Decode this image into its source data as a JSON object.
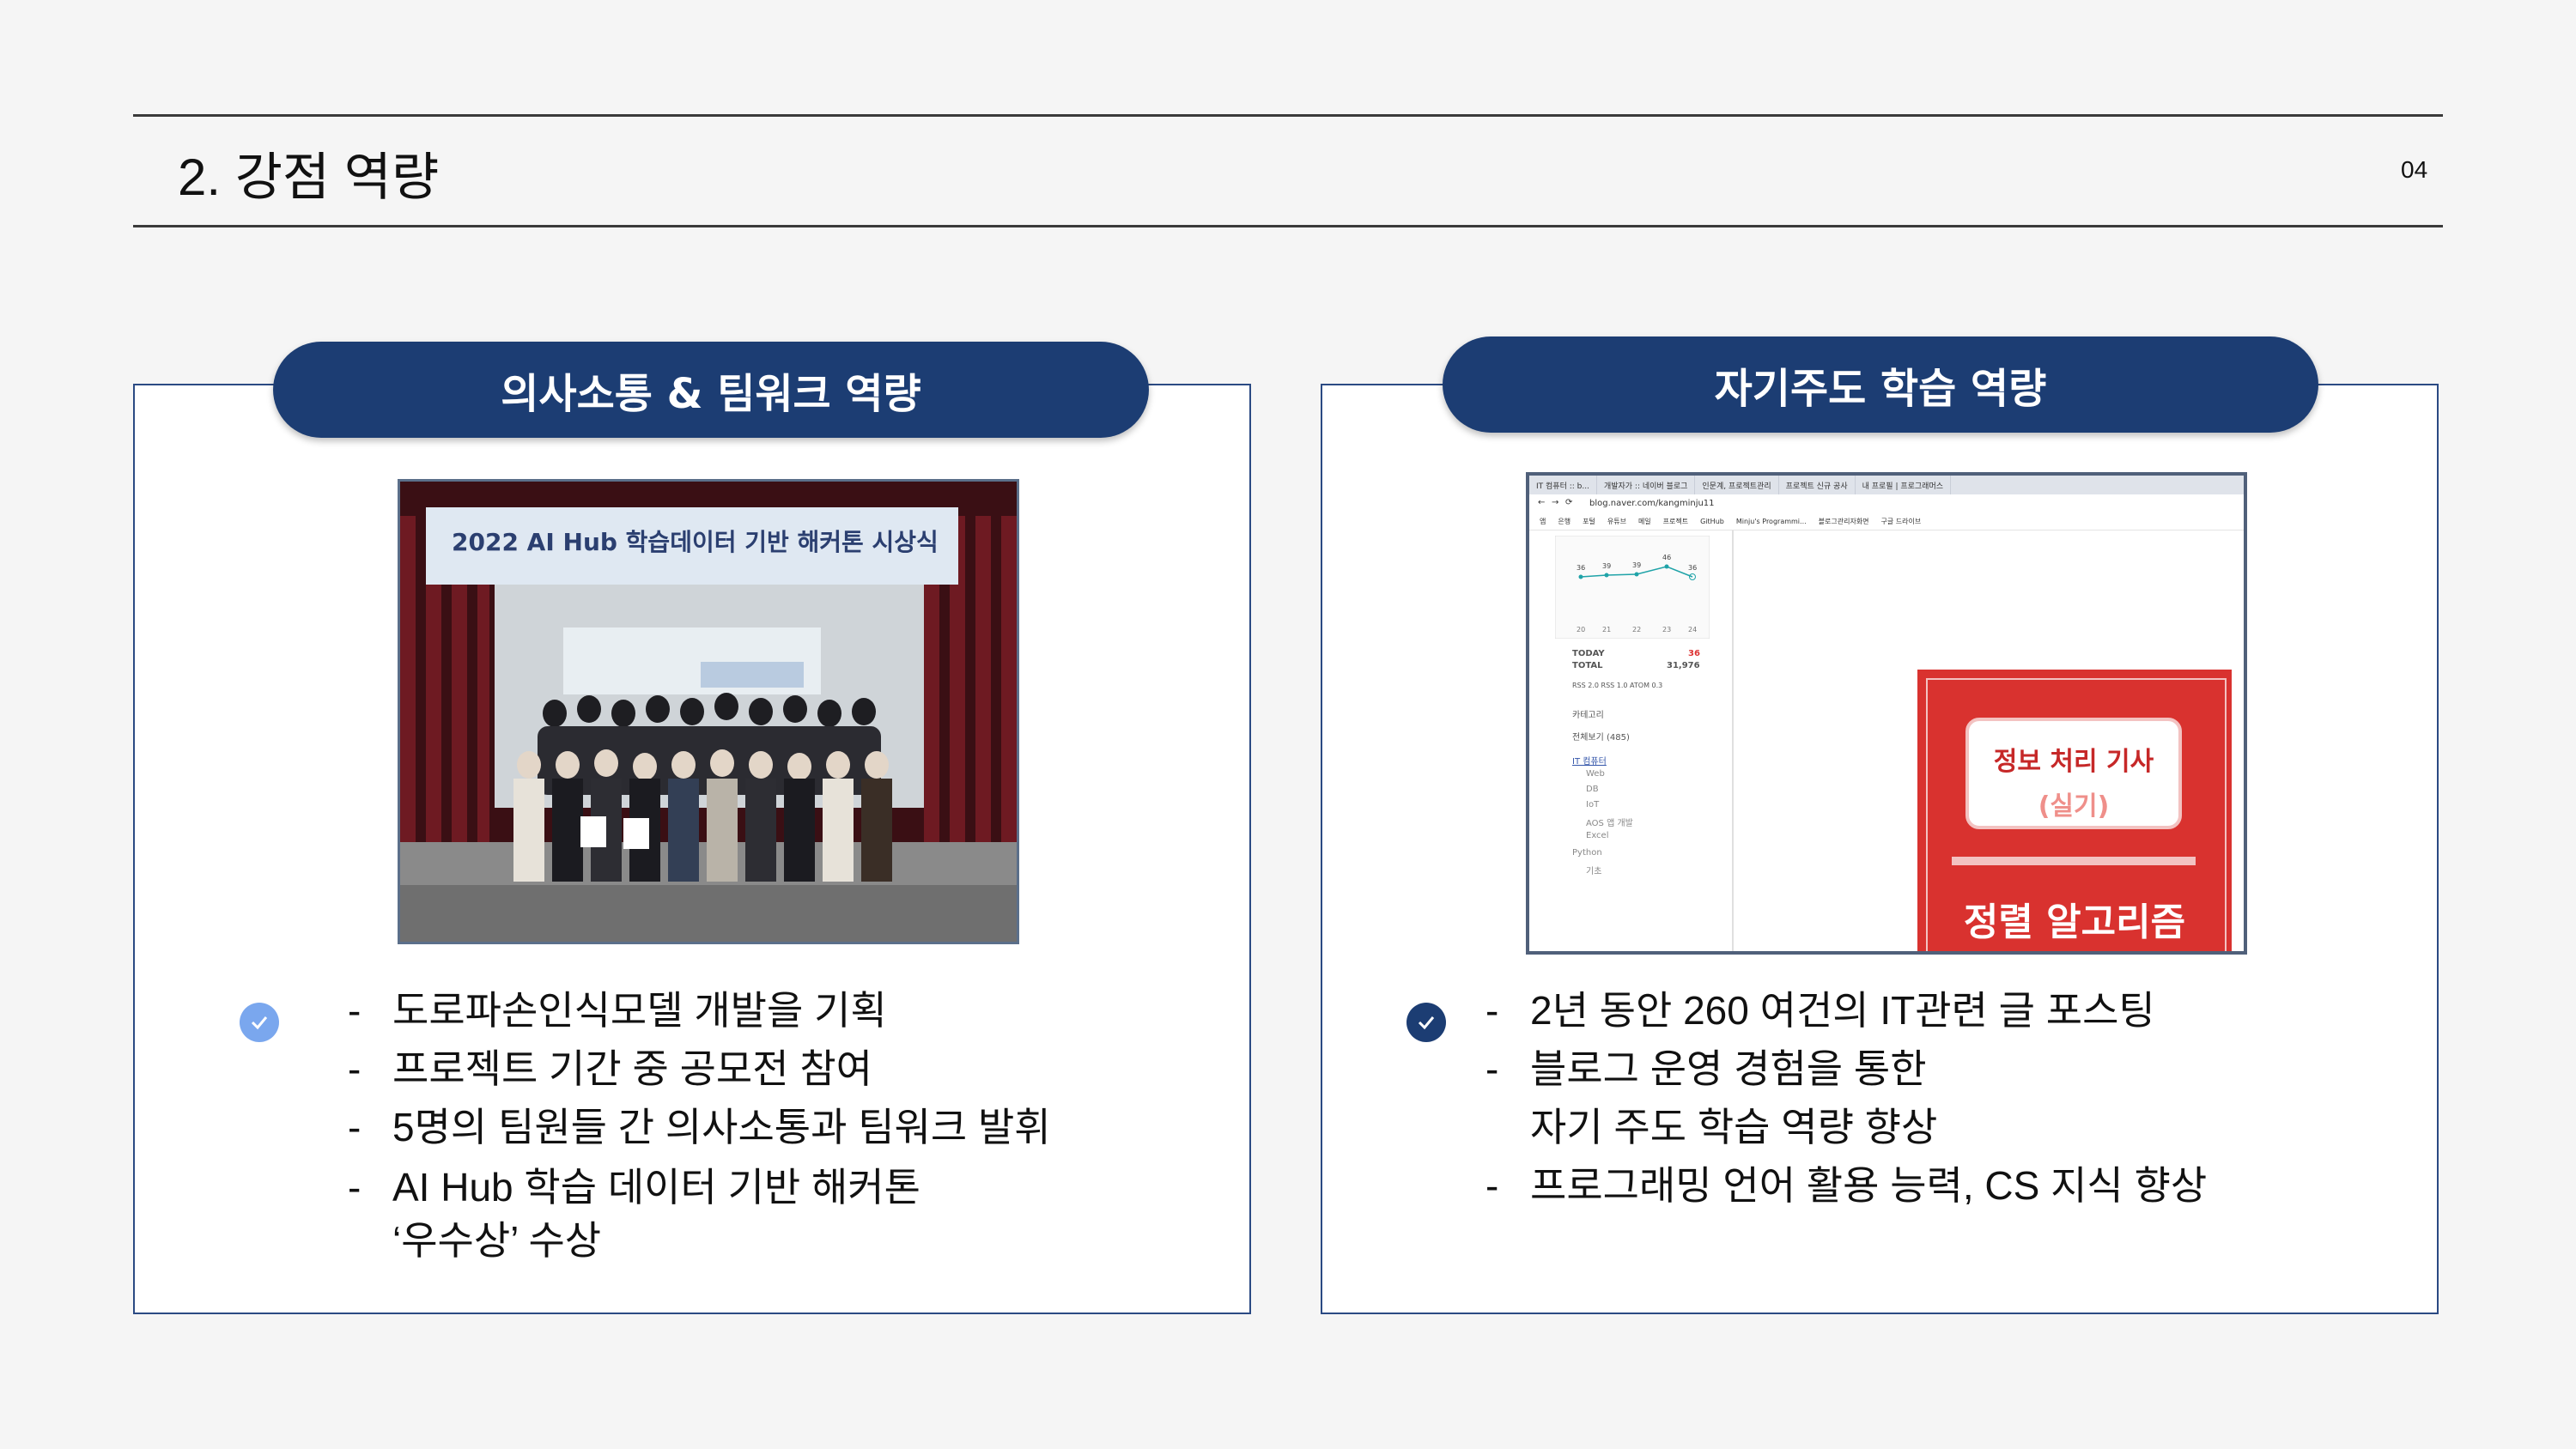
{
  "header": {
    "title": "2. 강점 역량",
    "page_number": "04"
  },
  "left_card": {
    "heading": "의사소통 & 팀워크 역량",
    "photo": {
      "banner_text": "2022 AI Hub 학습데이터 기반 해커톤 시상식",
      "description_icon": "group-photo-icon"
    },
    "bullets": [
      {
        "lines": [
          "도로파손인식모델 개발을 기획"
        ]
      },
      {
        "lines": [
          "프로젝트 기간 중 공모전 참여"
        ]
      },
      {
        "lines": [
          "5명의 팀원들 간 의사소통과 팀워크 발휘"
        ]
      },
      {
        "lines": [
          "AI Hub 학습 데이터 기반 해커톤",
          "‘우수상’ 수상"
        ]
      }
    ],
    "check_color": "#7aa7ee"
  },
  "right_card": {
    "heading": "자기주도 학습 역량",
    "screenshot": {
      "tabs": [
        "IT 컴퓨터 :: b...",
        "개발자가 :: 네이버 블로그",
        "인문계, 프로젝트관리",
        "프로젝트 신규 공사",
        "내 프로필 | 프로그래머스"
      ],
      "url": "blog.naver.com/kangminju11",
      "bookmarks": [
        "앱",
        "은행",
        "포털",
        "유튜브",
        "메일",
        "프로젝트",
        "GitHub",
        "Minju's Programmi...",
        "블로그관리자화면",
        "구글 드라이브"
      ],
      "graph_values": [
        "36",
        "39",
        "39",
        "46",
        "36"
      ],
      "graph_days": [
        "20",
        "21",
        "22",
        "23",
        "24"
      ],
      "today_label": "TODAY",
      "today_value": "36",
      "total_label": "TOTAL",
      "total_value": "31,976",
      "rss": "RSS 2.0   RSS 1.0   ATOM 0.3",
      "category_title": "카테고리",
      "categories": [
        "전체보기 (485)",
        "IT 컴퓨터",
        "Web",
        "DB",
        "IoT",
        "AOS 앱 개발",
        "Excel",
        "Python",
        "기초"
      ],
      "book_title": "정보 처리 기사",
      "book_subtitle": "(실기)",
      "book_bottom": "정렬 알고리즘"
    },
    "bullets": [
      {
        "lines": [
          "2년 동안 260 여건의 IT관련 글 포스팅"
        ]
      },
      {
        "lines": [
          "블로그 운영 경험을 통한",
          "자기 주도 학습 역량 향상"
        ]
      },
      {
        "lines": [
          "프로그래밍 언어 활용 능력, CS 지식 향상"
        ]
      }
    ],
    "check_color": "#1c3d73"
  },
  "colors": {
    "navy": "#1c3d73",
    "card_border": "#2b4a83",
    "background": "#f5f5f5"
  }
}
